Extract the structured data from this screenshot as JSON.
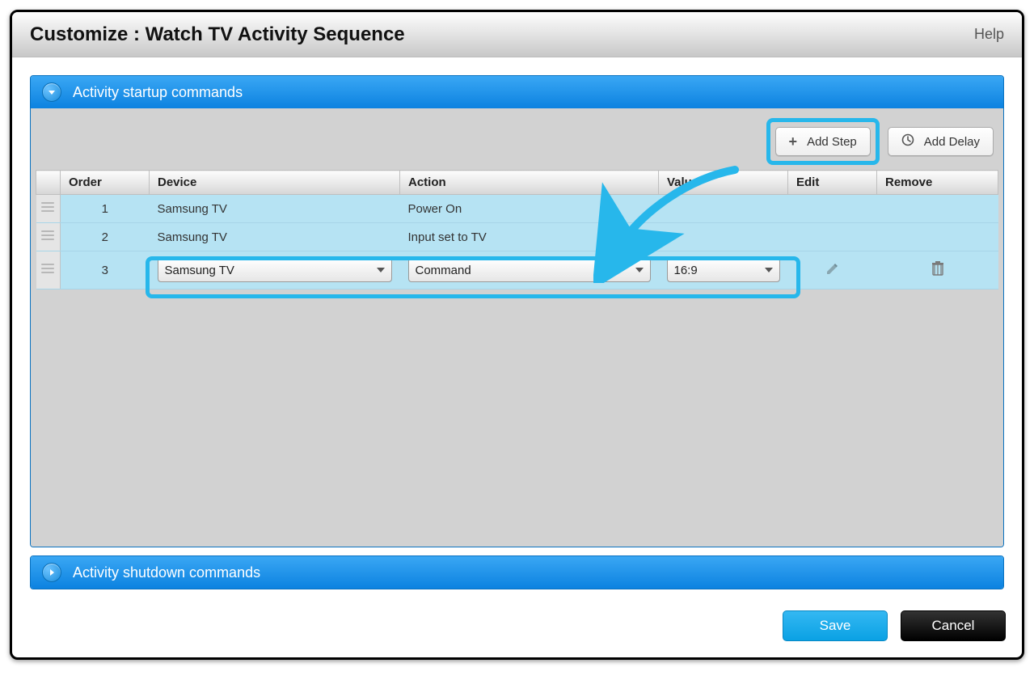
{
  "header": {
    "title": "Customize : Watch TV Activity Sequence",
    "help": "Help"
  },
  "panels": {
    "startup_title": "Activity startup commands",
    "shutdown_title": "Activity shutdown commands"
  },
  "buttons": {
    "add_step": "Add Step",
    "add_delay": "Add Delay",
    "save": "Save",
    "cancel": "Cancel"
  },
  "columns": {
    "order": "Order",
    "device": "Device",
    "action": "Action",
    "value": "Value",
    "edit": "Edit",
    "remove": "Remove"
  },
  "rows": [
    {
      "order": "1",
      "device": "Samsung TV",
      "action": "Power On",
      "value": ""
    },
    {
      "order": "2",
      "device": "Samsung TV",
      "action": "Input set to TV",
      "value": ""
    },
    {
      "order": "3",
      "device": "Samsung TV",
      "action": "Command",
      "value": "16:9"
    }
  ]
}
